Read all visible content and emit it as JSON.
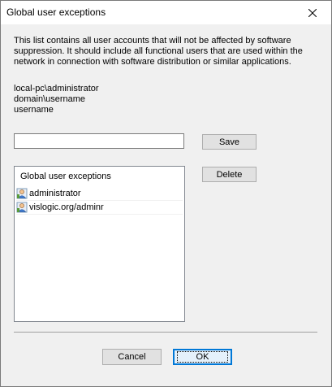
{
  "window": {
    "title": "Global user exceptions"
  },
  "description": {
    "lines": [
      "This list contains all user accounts that will not be affected by software",
      "suppression. It should include all functional users that are used within the",
      "network in connection with software distribution or similar applications."
    ]
  },
  "examples": [
    "local-pc\\administrator",
    "domain\\username",
    "username"
  ],
  "input": {
    "value": "",
    "placeholder": ""
  },
  "buttons": {
    "save": "Save",
    "delete": "Delete",
    "cancel": "Cancel",
    "ok": "OK"
  },
  "list": {
    "header": "Global user exceptions",
    "items": [
      {
        "label": "administrator",
        "icon": "user-icon"
      },
      {
        "label": "vislogic.org/adminr",
        "icon": "user-icon"
      }
    ]
  }
}
